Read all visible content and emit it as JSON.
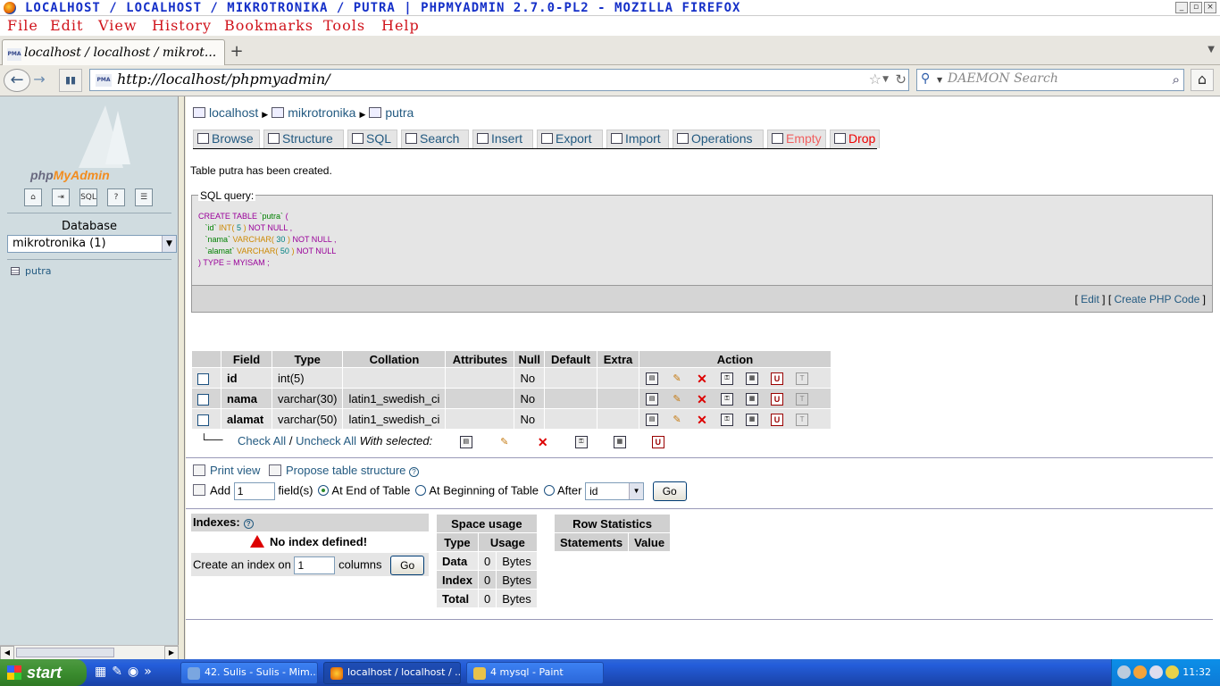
{
  "window": {
    "title": "LOCALHOST / LOCALHOST / MIKROTRONIKA / PUTRA | PHPMYADMIN 2.7.0-PL2 - MOZILLA FIREFOX"
  },
  "menu": {
    "items": [
      "File",
      "Edit",
      "View",
      "History",
      "Bookmarks",
      "Tools",
      "Help"
    ]
  },
  "browser": {
    "tab_label": "localhost / localhost / mikrot...",
    "url": "http://localhost/phpmyadmin/",
    "search_placeholder": "DAEMON Search"
  },
  "left": {
    "logo_php": "php",
    "logo_myadmin": "MyAdmin",
    "database_label": "Database",
    "database_selected": "mikrotronika (1)",
    "tables": [
      "putra"
    ]
  },
  "breadcrumb": {
    "server": "localhost",
    "database": "mikrotronika",
    "table": "putra"
  },
  "tabs": [
    "Browse",
    "Structure",
    "SQL",
    "Search",
    "Insert",
    "Export",
    "Import",
    "Operations",
    "Empty",
    "Drop"
  ],
  "message": "Table putra has been created.",
  "sql": {
    "legend": "SQL query:",
    "edit_link": "Edit",
    "php_link": "Create PHP Code",
    "lines": {
      "l1a": "CREATE TABLE",
      "l1b": "`putra`",
      "l1c": "(",
      "l2a": "`id`",
      "l2b": "INT(",
      "l2c": "5",
      "l2d": ")",
      "l2e": "NOT NULL ,",
      "l3a": "`nama`",
      "l3b": "VARCHAR(",
      "l3c": "30",
      "l3d": ")",
      "l3e": "NOT NULL ,",
      "l4a": "`alamat`",
      "l4b": "VARCHAR(",
      "l4c": "50",
      "l4d": ")",
      "l4e": "NOT NULL",
      "l5": ") TYPE = MYISAM ;"
    }
  },
  "structure": {
    "headers": [
      "Field",
      "Type",
      "Collation",
      "Attributes",
      "Null",
      "Default",
      "Extra",
      "Action"
    ],
    "rows": [
      {
        "field": "id",
        "type": "int(5)",
        "collation": "",
        "attributes": "",
        "null": "No",
        "default": "",
        "extra": ""
      },
      {
        "field": "nama",
        "type": "varchar(30)",
        "collation": "latin1_swedish_ci",
        "attributes": "",
        "null": "No",
        "default": "",
        "extra": ""
      },
      {
        "field": "alamat",
        "type": "varchar(50)",
        "collation": "latin1_swedish_ci",
        "attributes": "",
        "null": "No",
        "default": "",
        "extra": ""
      }
    ],
    "check_all": "Check All",
    "separator": "/",
    "uncheck_all": "Uncheck All",
    "with_selected": "With selected:"
  },
  "actions": {
    "print_view": "Print view",
    "propose": "Propose table structure",
    "add_label": "Add",
    "add_value": "1",
    "fields_label": "field(s)",
    "at_end": "At End of Table",
    "at_beginning": "At Beginning of Table",
    "after": "After",
    "after_field": "id",
    "go": "Go"
  },
  "indexes": {
    "title": "Indexes:",
    "no_index": "No index defined!",
    "create_label": "Create an index on",
    "create_value": "1",
    "columns": "columns",
    "go": "Go"
  },
  "space": {
    "title": "Space usage",
    "col_type": "Type",
    "col_usage": "Usage",
    "rows": [
      {
        "label": "Data",
        "value": "0",
        "unit": "Bytes"
      },
      {
        "label": "Index",
        "value": "0",
        "unit": "Bytes"
      },
      {
        "label": "Total",
        "value": "0",
        "unit": "Bytes"
      }
    ]
  },
  "rowstats": {
    "title": "Row Statistics",
    "col_statements": "Statements",
    "col_value": "Value"
  },
  "taskbar": {
    "start": "start",
    "more": "»",
    "items": [
      "42. Sulis - Sulis - Mim...",
      "localhost / localhost / ...",
      "4 mysql - Paint"
    ],
    "clock": "11:32"
  },
  "colors": {
    "link": "#235a81",
    "title_text": "#1530c8",
    "menu_text": "#d0141c",
    "left_bg": "#d0dce0"
  }
}
